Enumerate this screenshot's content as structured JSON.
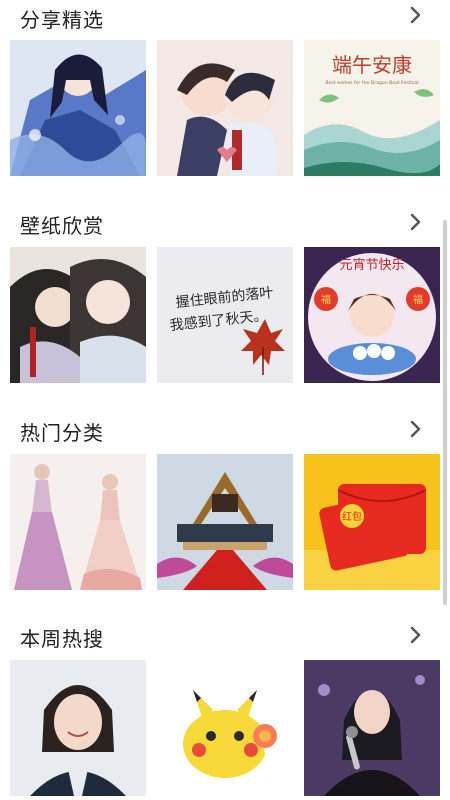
{
  "sections": [
    {
      "title": "分享精选",
      "more_icon": "chevron-right-icon",
      "tiles": [
        {
          "subject": "anime-girl-blue-dress-image",
          "caption": ""
        },
        {
          "subject": "anime-couple-chibi-image",
          "caption": ""
        },
        {
          "subject": "dragon-boat-festival-card-image",
          "caption": "端午安康",
          "sub_caption": "Best wishes for the Dragon Boat Festival"
        }
      ]
    },
    {
      "title": "壁纸欣赏",
      "more_icon": "chevron-right-icon",
      "tiles": [
        {
          "subject": "anime-two-men-image",
          "caption": ""
        },
        {
          "subject": "handwritten-maple-leaf-image",
          "caption": "握住眼前的落叶",
          "sub_caption": "我感到了秋天。"
        },
        {
          "subject": "lantern-festival-girl-image",
          "caption": "元宵节快乐",
          "badge": "福"
        }
      ]
    },
    {
      "title": "热门分类",
      "more_icon": "chevron-right-icon",
      "tiles": [
        {
          "subject": "pink-gown-dress-image",
          "caption": ""
        },
        {
          "subject": "palace-red-carpet-image",
          "caption": ""
        },
        {
          "subject": "red-envelope-image",
          "caption": "红包"
        }
      ]
    },
    {
      "title": "本周热搜",
      "more_icon": "chevron-right-icon",
      "tiles": [
        {
          "subject": "smiling-woman-portrait-image",
          "caption": ""
        },
        {
          "subject": "pikachu-lollipop-image",
          "caption": ""
        },
        {
          "subject": "singer-with-microphone-image",
          "caption": ""
        }
      ]
    }
  ],
  "colors": {
    "title_text": "#222222",
    "chevron": "#555555",
    "background": "#ffffff",
    "scrollbar": "#cfcfcf"
  }
}
